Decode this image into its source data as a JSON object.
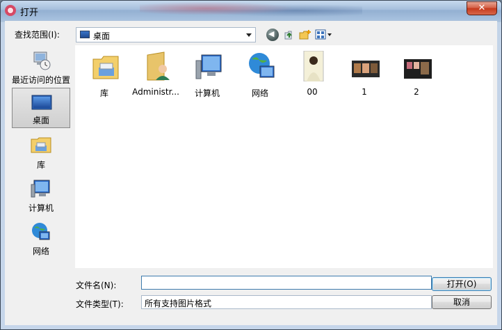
{
  "window": {
    "title": "打开",
    "close_glyph": "✕"
  },
  "look_in": {
    "label": "查找范围(I):",
    "value": "桌面"
  },
  "toolbar": {
    "back": "back-icon",
    "up": "up-folder-icon",
    "new_folder": "new-folder-icon",
    "views": "views-menu-icon"
  },
  "places": [
    {
      "label": "最近访问的位置",
      "icon": "recent-places-icon"
    },
    {
      "label": "桌面",
      "icon": "desktop-icon",
      "selected": true
    },
    {
      "label": "库",
      "icon": "libraries-icon"
    },
    {
      "label": "计算机",
      "icon": "computer-icon"
    },
    {
      "label": "网络",
      "icon": "network-icon"
    }
  ],
  "files": [
    {
      "label": "库",
      "icon": "libraries-folder-icon"
    },
    {
      "label": "Administr...",
      "icon": "user-folder-icon"
    },
    {
      "label": "计算机",
      "icon": "computer-icon"
    },
    {
      "label": "网络",
      "icon": "network-icon"
    },
    {
      "label": "00",
      "icon": "image-thumbnail"
    },
    {
      "label": "1",
      "icon": "image-thumbnail"
    },
    {
      "label": "2",
      "icon": "image-thumbnail"
    }
  ],
  "filename": {
    "label": "文件名(N):",
    "value": ""
  },
  "filetype": {
    "label": "文件类型(T):",
    "value": "所有支持图片格式"
  },
  "buttons": {
    "open": "打开(O)",
    "cancel": "取消"
  },
  "colors": {
    "accent": "#3c7fb1",
    "close": "#c5391c"
  }
}
